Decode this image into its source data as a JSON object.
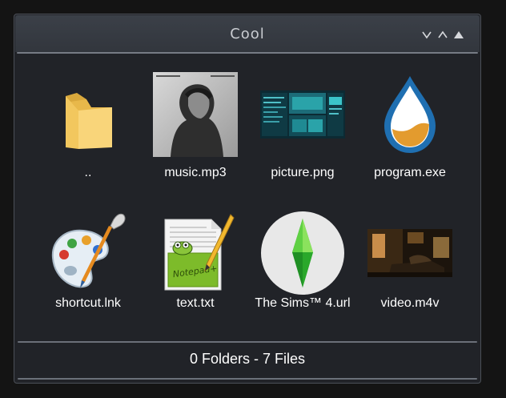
{
  "window": {
    "title": "Cool",
    "controls": [
      "collapse-down-icon",
      "collapse-up-icon",
      "expand-up-icon"
    ]
  },
  "files": [
    {
      "name": "..",
      "icon": "folder-icon"
    },
    {
      "name": "music.mp3",
      "icon": "album-art-thumbnail"
    },
    {
      "name": "picture.png",
      "icon": "screenshot-thumbnail"
    },
    {
      "name": "program.exe",
      "icon": "droplet-app-icon"
    },
    {
      "name": "shortcut.lnk",
      "icon": "paint-palette-icon"
    },
    {
      "name": "text.txt",
      "icon": "notepad-plus-plus-icon"
    },
    {
      "name": "The Sims™ 4.url",
      "icon": "sims-plumbob-icon"
    },
    {
      "name": "video.m4v",
      "icon": "video-thumbnail"
    }
  ],
  "footer": {
    "status": "0 Folders - 7 Files"
  },
  "colors": {
    "window_bg": "#212328",
    "title_bg": "#3b4048",
    "text": "#ffffff",
    "folder": "#f7cf6d"
  }
}
